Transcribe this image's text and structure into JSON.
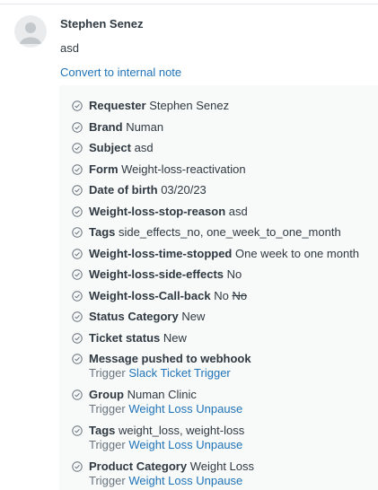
{
  "comment": {
    "author": "Stephen Senez",
    "message": "asd",
    "convert_link": "Convert to internal note"
  },
  "events": [
    {
      "key": "Requester",
      "value": "Stephen Senez"
    },
    {
      "key": "Brand",
      "value": "Numan"
    },
    {
      "key": "Subject",
      "value": "asd"
    },
    {
      "key": "Form",
      "value": "Weight-loss-reactivation"
    },
    {
      "key": "Date of birth",
      "value": "03/20/23"
    },
    {
      "key": "Weight-loss-stop-reason",
      "value": "asd"
    },
    {
      "key": "Tags",
      "value": "side_effects_no, one_week_to_one_month"
    },
    {
      "key": "Weight-loss-time-stopped",
      "value": "One week to one month"
    },
    {
      "key": "Weight-loss-side-effects",
      "value": "No"
    },
    {
      "key": "Weight-loss-Call-back",
      "value": "No",
      "previous": "No"
    },
    {
      "key": "Status Category",
      "value": "New"
    },
    {
      "key": "Ticket status",
      "value": "New"
    },
    {
      "key": "Message pushed to webhook",
      "value": "",
      "trigger_label": "Trigger",
      "trigger": "Slack Ticket Trigger"
    },
    {
      "key": "Group",
      "value": "Numan Clinic",
      "trigger_label": "Trigger",
      "trigger": "Weight Loss Unpause"
    },
    {
      "key": "Tags",
      "value": "weight_loss, weight-loss",
      "trigger_label": "Trigger",
      "trigger": "Weight Loss Unpause"
    },
    {
      "key": "Product Category",
      "value": "Weight Loss",
      "trigger_label": "Trigger",
      "trigger": "Weight Loss Unpause"
    }
  ],
  "icons": {
    "avatar": "default-user-avatar-icon",
    "event": "check-circle-icon"
  },
  "colors": {
    "link": "#1f73b7",
    "text": "#2f3941",
    "muted": "#68737d",
    "events_background": "#f8f9f9"
  }
}
